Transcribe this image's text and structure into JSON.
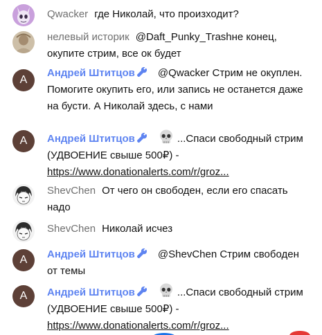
{
  "messages": [
    {
      "author": "Qwacker",
      "text": "где Николай, что произходит?"
    },
    {
      "author": "нелевый историк",
      "text": "@Daft_Punky_Trashне конец, окупите стрим, все ок будет"
    },
    {
      "author": "Андрей Штитцов",
      "avatar_letter": "А",
      "text": "@Qwacker Стрим не окуплен. Помогите окупить его, или запись не останется даже на бусти. А Николай здесь, с нами"
    },
    {
      "author": "Андрей Штитцов",
      "avatar_letter": "А",
      "text": "...Спаси свободный стрим (УДВОЕНИЕ свыше 500₽) - ",
      "link": "https://www.donationalerts.com/r/groz..."
    },
    {
      "author": "ShevChen",
      "text": "От чего он свободен, если его спасать надо"
    },
    {
      "author": "ShevChen",
      "text": "Николай исчез"
    },
    {
      "author": "Андрей Штитцов",
      "avatar_letter": "А",
      "text": "@ShevChen Стрим свободен от темы"
    },
    {
      "author": "Андрей Штитцов",
      "avatar_letter": "А",
      "text": "...Спаси свободный стрим (УДВОЕНИЕ свыше 500₽) - ",
      "link": "https://www.donationalerts.com/r/groz..."
    }
  ],
  "colors": {
    "owner_name": "#5e84f1",
    "regular_name": "#6f6f6f",
    "avatar_letter_bg": "#5d4037",
    "text": "#111111"
  },
  "icons": {
    "owner_badge": "wrench-icon",
    "emoji": "skull-icon"
  }
}
